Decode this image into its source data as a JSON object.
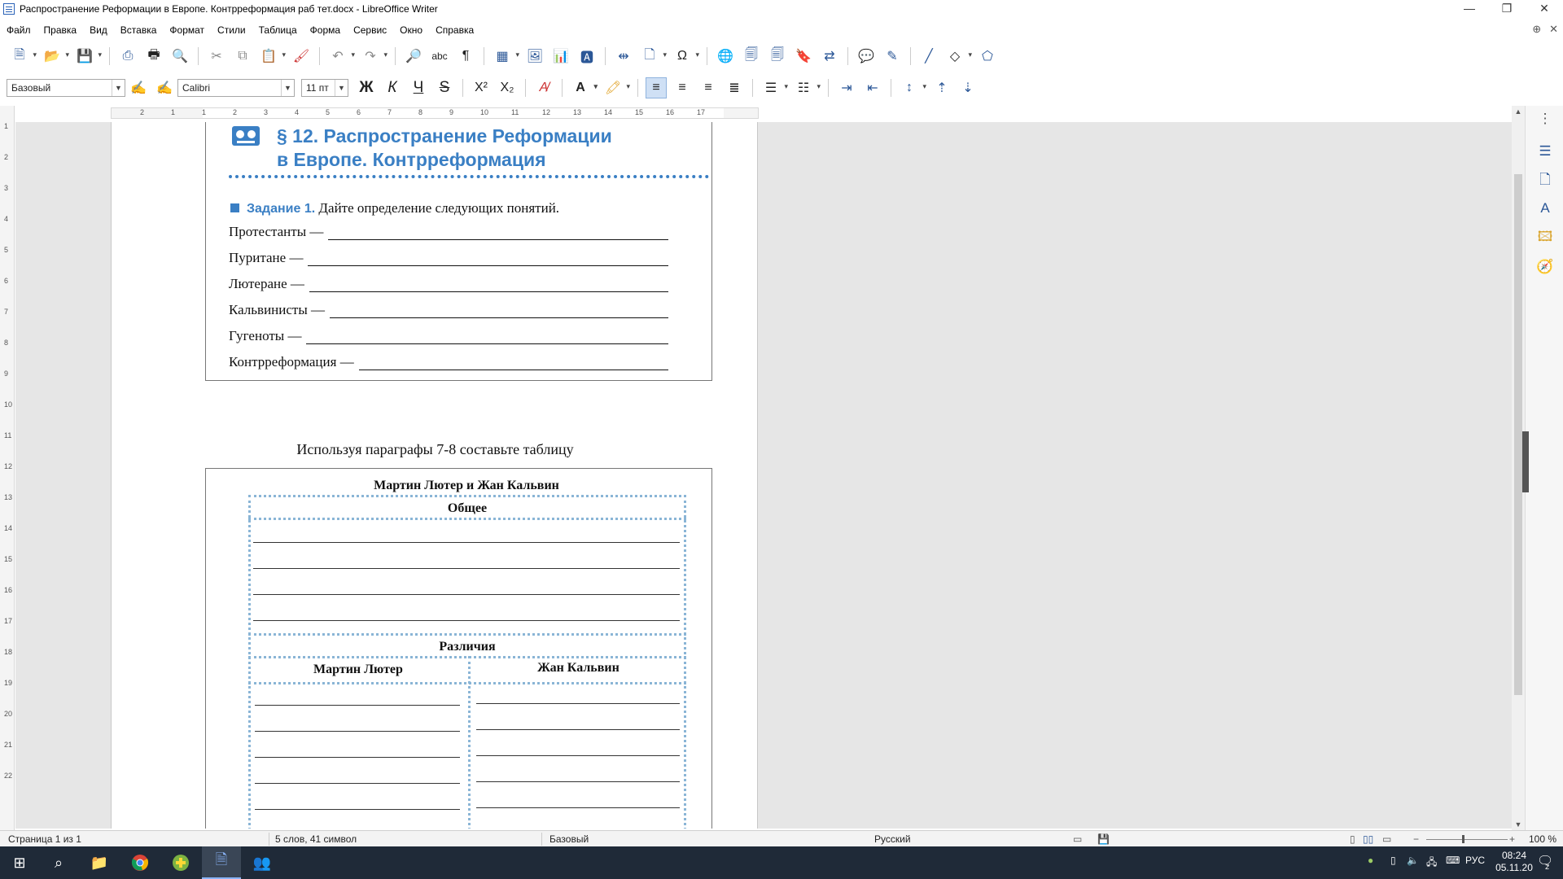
{
  "window": {
    "title": "Распространение Реформации в Европе. Контрреформация раб тет.docx - LibreOffice Writer",
    "minimize_glyph": "—",
    "restore_glyph": "❐",
    "close_glyph": "✕"
  },
  "menu": {
    "items": [
      "Файл",
      "Правка",
      "Вид",
      "Вставка",
      "Формат",
      "Стили",
      "Таблица",
      "Форма",
      "Сервис",
      "Окно",
      "Справка"
    ],
    "right_globe_glyph": "⊕",
    "right_close_glyph": "✕"
  },
  "formatting": {
    "paragraph_style": "Базовый",
    "font_name": "Calibri",
    "font_size": "11 пт",
    "bold_glyph": "Ж",
    "italic_glyph": "К",
    "underline_glyph": "Ч",
    "strike_glyph": "S",
    "superscript_glyph": "X²",
    "subscript_glyph": "X₂"
  },
  "ruler": {
    "h_numbers": [
      "2",
      "1",
      "1",
      "2",
      "3",
      "4",
      "5",
      "6",
      "7",
      "8",
      "9",
      "10",
      "11",
      "12",
      "13",
      "14",
      "15",
      "16",
      "17"
    ],
    "v_numbers": [
      "1",
      "2",
      "3",
      "4",
      "5",
      "6",
      "7",
      "8",
      "9",
      "10",
      "11",
      "12",
      "13",
      "14",
      "15",
      "16",
      "17",
      "18",
      "19",
      "20",
      "21",
      "22"
    ]
  },
  "document": {
    "image1": {
      "heading_line1": "§ 12. Распространение Реформации",
      "heading_line2": "в Европе. Контрреформация",
      "task_label": "Задание 1.",
      "task_text": "Дайте определение следующих понятий.",
      "terms": [
        "Протестанты —",
        "Пуритане —",
        "Лютеране —",
        "Кальвинисты —",
        "Гугеноты —",
        "Контрреформация —"
      ]
    },
    "caption": "Используя параграфы 7-8 составьте таблицу",
    "image2": {
      "title": "Мартин Лютер и Жан Кальвин",
      "common": "Общее",
      "differences": "Различия",
      "col_left": "Мартин Лютер",
      "col_right": "Жан Кальвин"
    }
  },
  "status": {
    "page": "Страница 1 из 1",
    "words": "5 слов, 41 символ",
    "style": "Базовый",
    "language": "Русский",
    "zoom": "100 %"
  },
  "taskbar": {
    "lang": "РУС",
    "time": "08:24",
    "date": "05.11.20",
    "notifications": "2"
  },
  "colors": {
    "accent_blue": "#3a7fc4",
    "dotted_table": "#8ab5d6",
    "taskbar_bg": "#1f2a38"
  }
}
